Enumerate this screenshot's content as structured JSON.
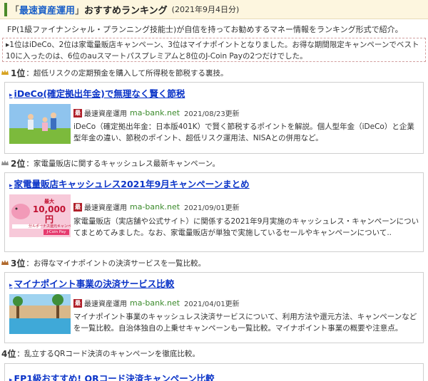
{
  "header": {
    "open_quote": "「",
    "brand": "最速資産運用",
    "close_quote": "」",
    "title_rest": "おすすめランキング",
    "date": "(2021年9月4日分)"
  },
  "intro": "FP(1級ファイナンシャル・プランニング技能士)が自信を持ってお勧めするマネー情報をランキング形式で紹介。",
  "notice": "▸1位はiDeCo、2位は家電量販店キャンペーン、3位はマイナポイントとなりました。お得な期間限定キャンペーンでベスト10に入ったのは、6位のauスマートパスプレミアムと8位のJ-Coin Payの2つだけでした。",
  "colors": {
    "gold": "#d7a21f",
    "silver": "#8e8e8e",
    "bronze": "#b0682a",
    "link": "#0b34c8",
    "domain": "#3a8a2a",
    "brand": "#1a5fc8"
  },
  "ranks": [
    {
      "num": "1位",
      "desc": "：超低リスクの定期預金を購入して所得税を節税する裏技。",
      "crown_icon": "gold-crown-icon",
      "card": {
        "title": "iDeCo(確定拠出年金)で無理なく賢く節税",
        "site": "最速資産運用",
        "domain": "ma-bank.net",
        "date": "2021/08/23更新",
        "desc": "iDeCo（確定拠出年金：日本版401K）で賢く節税するポイントを解説。個人型年金（iDeCo）と企業型年金の違い、節税のポイント、超低リスク運用法、NISAとの併用など。"
      }
    },
    {
      "num": "2位",
      "desc": "：家電量販店に関するキャッシュレス最新キャンペーン。",
      "crown_icon": "silver-crown-icon",
      "card": {
        "title": "家電量販店キャッシュレス2021年9月キャンペーンまとめ",
        "site": "最速資産運用",
        "domain": "ma-bank.net",
        "date": "2021/09/01更新",
        "desc": "家電量販店（実店舗や公式サイト）に関係する2021年9月実施のキャッシュレス・キャンペーンについてまとめてみました。なお、家電量販店が単独で実施しているセールやキャンペーンについて.."
      },
      "thumb": {
        "big": "最大",
        "amount": "10,000円",
        "sub": "分ルポーナス還元キャンペーン",
        "badge": "J-Coin Pay"
      }
    },
    {
      "num": "3位",
      "desc": "：お得なマイナポイントの決済サービスを一覧比較。",
      "crown_icon": "bronze-crown-icon",
      "card": {
        "title": "マイナポイント事業の決済サービス比較",
        "site": "最速資産運用",
        "domain": "ma-bank.net",
        "date": "2021/04/01更新",
        "desc": "マイナポイント事業のキャッシュレス決済サービスについて、利用方法や還元方法、キャンペーンなどを一覧比較。自治体独自の上乗せキャンペーンも一覧比較。マイナポイント事業の概要や注意点。"
      }
    },
    {
      "num": "4位",
      "desc": "：乱立するQRコード決済のキャンペーンを徹底比較。",
      "card": {
        "title": "FP1級おすすめ! QRコード決済キャンペーン比較"
      }
    }
  ]
}
